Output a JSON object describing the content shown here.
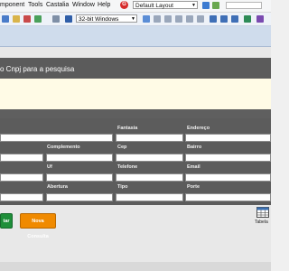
{
  "menubar": {
    "items": [
      "mponent",
      "Tools",
      "Castalia",
      "Window",
      "Help"
    ],
    "layout_combo": "Default Layout"
  },
  "toolbar": {
    "platform_combo": "32-bit Windows"
  },
  "form": {
    "title": "o Cnpj para a pesquisa",
    "labels": {
      "fantasia": "Fantasia",
      "endereco": "Endereço",
      "complemento": "Complemento",
      "cep": "Cep",
      "bairro": "Bairro",
      "uf": "Uf",
      "telefone": "Telefone",
      "email": "Email",
      "abertura": "Abertura",
      "tipo": "Tipo",
      "porte": "Porte"
    },
    "buttons": {
      "left": "tar",
      "nova_consulta": "Nova Consulta"
    },
    "tabela_label": "Tabela"
  },
  "colors": {
    "panel": "#5c5c5c",
    "hint_strip": "#fffbe6",
    "green_button": "#1f8f3a",
    "orange_button": "#f08a00"
  }
}
